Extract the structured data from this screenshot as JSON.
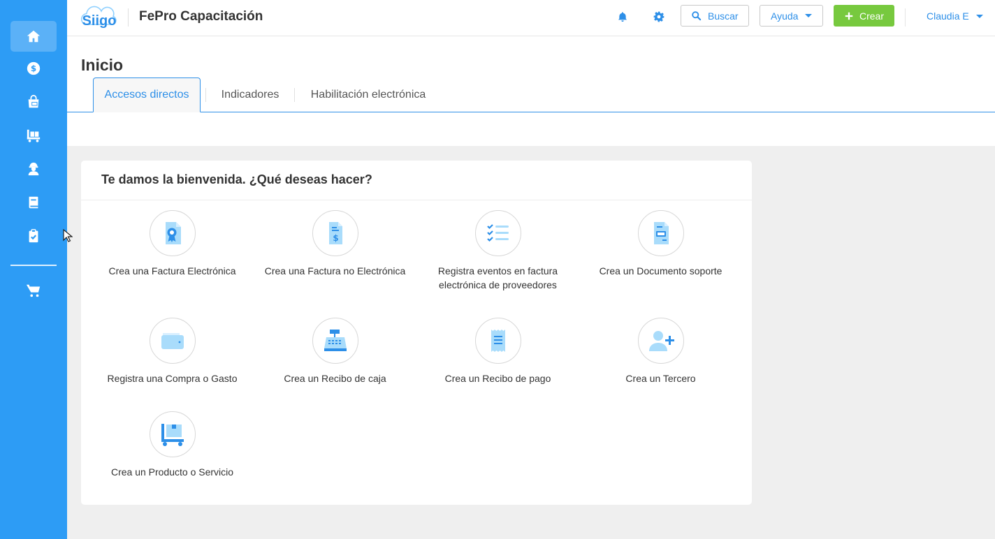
{
  "app": {
    "logo_text": "Siigo",
    "company_name": "FePro Capacitación",
    "brand_color": "#2d9cf5",
    "accent_color": "#2d8fe8",
    "create_color": "#77c93e"
  },
  "sidebar": {
    "items": [
      {
        "icon": "home-icon",
        "active": true
      },
      {
        "icon": "dollar-coin-icon"
      },
      {
        "icon": "shopping-bag-icon"
      },
      {
        "icon": "warehouse-cart-icon"
      },
      {
        "icon": "employee-icon"
      },
      {
        "icon": "book-icon"
      },
      {
        "icon": "clipboard-check-icon"
      },
      {
        "icon": "cart-icon"
      }
    ]
  },
  "header": {
    "notifications_icon": "bell-icon",
    "settings_icon": "gear-icon",
    "search_label": "Buscar",
    "help_label": "Ayuda",
    "create_label": "Crear",
    "user_name": "Claudia E"
  },
  "page": {
    "title": "Inicio",
    "tabs": [
      {
        "label": "Accesos directos",
        "active": true
      },
      {
        "label": "Indicadores"
      },
      {
        "label": "Habilitación electrónica"
      }
    ]
  },
  "welcome": {
    "title": "Te damos la bienvenida. ¿Qué deseas hacer?",
    "actions": [
      {
        "label": "Crea una Factura Electrónica",
        "icon": "electronic-invoice-icon"
      },
      {
        "label": "Crea una Factura no Electrónica",
        "icon": "invoice-dollar-icon"
      },
      {
        "label": "Registra eventos en factura electrónica de proveedores",
        "icon": "checklist-icon"
      },
      {
        "label": "Crea un Documento soporte",
        "icon": "support-document-icon"
      },
      {
        "label": "Registra una Compra o Gasto",
        "icon": "wallet-icon"
      },
      {
        "label": "Crea un Recibo de caja",
        "icon": "cash-register-icon"
      },
      {
        "label": "Crea un Recibo de pago",
        "icon": "receipt-icon"
      },
      {
        "label": "Crea un Tercero",
        "icon": "add-person-icon"
      },
      {
        "label": "Crea un Producto o Servicio",
        "icon": "product-cart-icon"
      }
    ]
  }
}
